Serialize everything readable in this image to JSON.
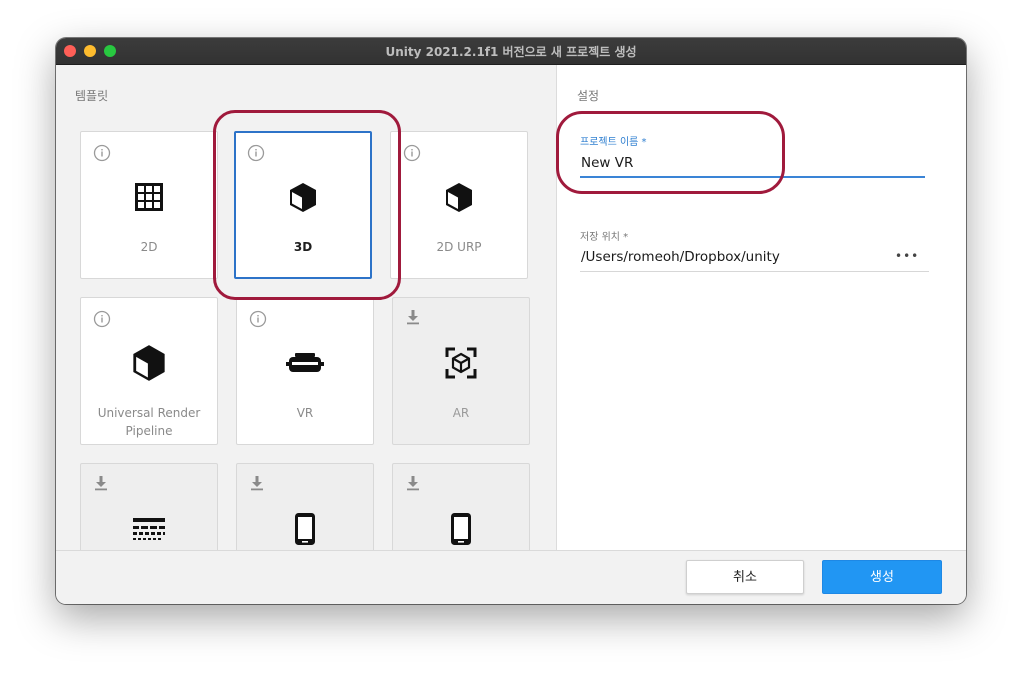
{
  "window": {
    "title": "Unity 2021.2.1f1 버전으로 새 프로젝트 생성"
  },
  "templates": {
    "section_title": "템플릿",
    "items": [
      {
        "label": "2D",
        "icon": "grid-icon",
        "state": "available"
      },
      {
        "label": "3D",
        "icon": "cube-icon",
        "state": "selected"
      },
      {
        "label": "2D URP",
        "icon": "cube-icon",
        "state": "available"
      },
      {
        "label": "Universal Render Pipeline",
        "icon": "cube-icon",
        "state": "available"
      },
      {
        "label": "VR",
        "icon": "vr-headset-icon",
        "state": "available"
      },
      {
        "label": "AR",
        "icon": "ar-cube-icon",
        "state": "download"
      },
      {
        "label": "",
        "icon": "terrain-icon",
        "state": "download"
      },
      {
        "label": "",
        "icon": "phone-icon",
        "state": "download"
      },
      {
        "label": "",
        "icon": "phone-icon",
        "state": "download"
      }
    ]
  },
  "settings": {
    "section_title": "설정",
    "project_name": {
      "label": "프로젝트 이름 *",
      "value": "New VR"
    },
    "location": {
      "label": "저장 위치 *",
      "value": "/Users/romeoh/Dropbox/unity",
      "more": "•••"
    }
  },
  "footer": {
    "cancel_label": "취소",
    "create_label": "생성"
  },
  "colors": {
    "accent": "#2196f3",
    "highlight": "#a01a3c",
    "selected_border": "#2d73c8"
  }
}
